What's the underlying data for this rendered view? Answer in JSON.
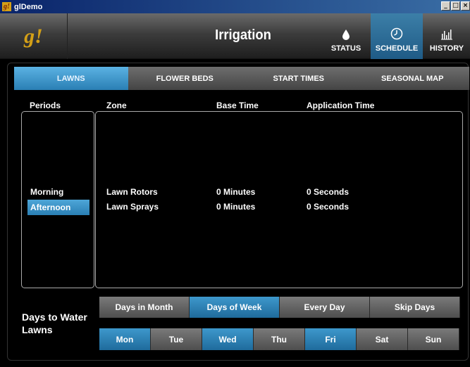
{
  "window": {
    "icon_text": "g!",
    "title": "glDemo",
    "controls": [
      "_",
      "□",
      "×"
    ]
  },
  "header": {
    "logo_text": "g!",
    "title": "Irrigation",
    "nav": [
      {
        "label": "STATUS",
        "icon": "water-drop-icon",
        "glyph": "💧"
      },
      {
        "label": "SCHEDULE",
        "icon": "clock-icon",
        "glyph": "🕘",
        "active": true
      },
      {
        "label": "HISTORY",
        "icon": "bar-chart-icon",
        "glyph": "📊"
      }
    ]
  },
  "tabs": [
    {
      "label": "LAWNS",
      "active": true
    },
    {
      "label": "FLOWER BEDS"
    },
    {
      "label": "START TIMES"
    },
    {
      "label": "SEASONAL MAP"
    }
  ],
  "columns": {
    "periods": "Periods",
    "zone": "Zone",
    "base_time": "Base Time",
    "application_time": "Application Time"
  },
  "periods": [
    {
      "label": "Morning"
    },
    {
      "label": "Afternoon",
      "selected": true
    }
  ],
  "zones": [
    {
      "zone": "Lawn Rotors",
      "base_time": "0 Minutes",
      "application_time": "0 Seconds"
    },
    {
      "zone": "Lawn Sprays",
      "base_time": "0 Minutes",
      "application_time": "0 Seconds"
    }
  ],
  "days_to_water": {
    "label_line1": "Days to Water",
    "label_line2": "Lawns",
    "modes": [
      {
        "label": "Days in Month"
      },
      {
        "label": "Days of Week",
        "active": true
      },
      {
        "label": "Every Day"
      },
      {
        "label": "Skip Days"
      }
    ],
    "days": [
      {
        "label": "Mon",
        "active": true
      },
      {
        "label": "Tue"
      },
      {
        "label": "Wed",
        "active": true
      },
      {
        "label": "Thu"
      },
      {
        "label": "Fri",
        "active": true
      },
      {
        "label": "Sat"
      },
      {
        "label": "Sun"
      }
    ]
  },
  "colors": {
    "accent": "#2a7fb4",
    "logo": "#d4a017"
  }
}
